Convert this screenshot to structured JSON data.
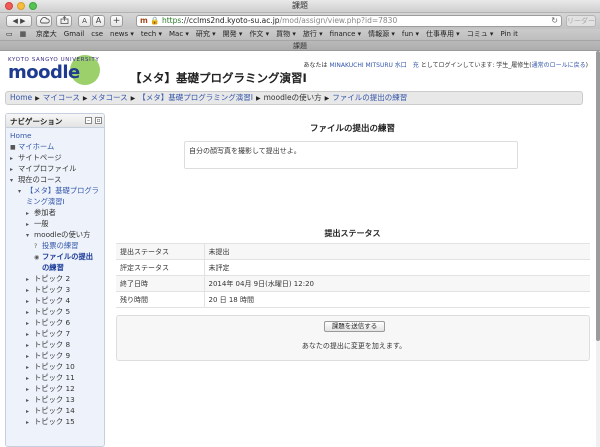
{
  "window": {
    "title": "課題"
  },
  "toolbar": {
    "font_small": "A",
    "font_large": "A",
    "new_tab": "+",
    "url_scheme": "https",
    "url_host": "cclms2nd.kyoto-su.ac.jp",
    "url_path": "/mod/assign/view.php?id=7830",
    "reader": "リーダー"
  },
  "bookmarks": [
    "京産大",
    "Gmail",
    "cse",
    "news ▾",
    "tech ▾",
    "Mac ▾",
    "研究 ▾",
    "開発 ▾",
    "作文 ▾",
    "買物 ▾",
    "旅行 ▾",
    "finance ▾",
    "情報源 ▾",
    "fun ▾",
    "仕事専用 ▾",
    "コミュ ▾",
    "Pin it"
  ],
  "tab": {
    "label": "課題"
  },
  "header": {
    "logo_top": "KYOTO SANGYO UNIVERSITY",
    "logo_word": "moodle",
    "course_title": "【メタ】基礎プログラミング演習I",
    "login_prefix": "あなたは ",
    "login_user": "MINAKUCHI MITSURU 水口　充",
    "login_mid": " としてログインしています: 学生_履修生(",
    "login_return": "通常のロールに戻る",
    "login_suffix": ")"
  },
  "breadcrumb": [
    {
      "label": "Home",
      "link": true
    },
    {
      "label": "マイコース",
      "link": true
    },
    {
      "label": "メタコース",
      "link": true
    },
    {
      "label": "【メタ】基礎プログラミング演習I",
      "link": true
    },
    {
      "label": "moodleの使い方",
      "link": false
    },
    {
      "label": "ファイルの提出の練習",
      "link": true
    }
  ],
  "navigation": {
    "title": "ナビゲーション",
    "items": [
      {
        "label": "Home",
        "marker": "",
        "indent": 0,
        "style": "link"
      },
      {
        "label": "マイホーム",
        "marker": "■",
        "indent": 0,
        "style": "link"
      },
      {
        "label": "サイトページ",
        "marker": "▸",
        "indent": 0,
        "style": "text"
      },
      {
        "label": "マイプロファイル",
        "marker": "▸",
        "indent": 0,
        "style": "text"
      },
      {
        "label": "現在のコース",
        "marker": "▾",
        "indent": 0,
        "style": "text"
      },
      {
        "label": "【メタ】基礎プログラ",
        "marker": "▾",
        "indent": 1,
        "style": "link"
      },
      {
        "label": "ミング演習I",
        "marker": "",
        "indent": 2,
        "style": "link"
      },
      {
        "label": "参加者",
        "marker": "▸",
        "indent": 2,
        "style": "text"
      },
      {
        "label": "一般",
        "marker": "▸",
        "indent": 2,
        "style": "text"
      },
      {
        "label": "moodleの使い方",
        "marker": "▾",
        "indent": 2,
        "style": "text"
      },
      {
        "label": "投票の練習",
        "marker": "?",
        "indent": 3,
        "style": "link"
      },
      {
        "label": "ファイルの提出",
        "marker": "◉",
        "indent": 3,
        "style": "current"
      },
      {
        "label": "の練習",
        "marker": "",
        "indent": 4,
        "style": "current"
      },
      {
        "label": "トピック 2",
        "marker": "▸",
        "indent": 2,
        "style": "text"
      },
      {
        "label": "トピック 3",
        "marker": "▸",
        "indent": 2,
        "style": "text"
      },
      {
        "label": "トピック 4",
        "marker": "▸",
        "indent": 2,
        "style": "text"
      },
      {
        "label": "トピック 5",
        "marker": "▸",
        "indent": 2,
        "style": "text"
      },
      {
        "label": "トピック 6",
        "marker": "▸",
        "indent": 2,
        "style": "text"
      },
      {
        "label": "トピック 7",
        "marker": "▸",
        "indent": 2,
        "style": "text"
      },
      {
        "label": "トピック 8",
        "marker": "▸",
        "indent": 2,
        "style": "text"
      },
      {
        "label": "トピック 9",
        "marker": "▸",
        "indent": 2,
        "style": "text"
      },
      {
        "label": "トピック 10",
        "marker": "▸",
        "indent": 2,
        "style": "text"
      },
      {
        "label": "トピック 11",
        "marker": "▸",
        "indent": 2,
        "style": "text"
      },
      {
        "label": "トピック 12",
        "marker": "▸",
        "indent": 2,
        "style": "text"
      },
      {
        "label": "トピック 13",
        "marker": "▸",
        "indent": 2,
        "style": "text"
      },
      {
        "label": "トピック 14",
        "marker": "▸",
        "indent": 2,
        "style": "text"
      },
      {
        "label": "トピック 15",
        "marker": "▸",
        "indent": 2,
        "style": "text"
      }
    ]
  },
  "main": {
    "heading": "ファイルの提出の練習",
    "intro": "自分の顔写真を撮影して提出せよ。",
    "status_heading": "提出ステータス",
    "status_rows": [
      {
        "label": "提出ステータス",
        "value": "未提出"
      },
      {
        "label": "評定ステータス",
        "value": "未評定"
      },
      {
        "label": "終了日時",
        "value": "2014年 04月 9日(水曜日) 12:20"
      },
      {
        "label": "残り時間",
        "value": "20 日 18 時間"
      }
    ],
    "submit_button": "課題を送信する",
    "submit_note": "あなたの提出に変更を加えます。"
  }
}
